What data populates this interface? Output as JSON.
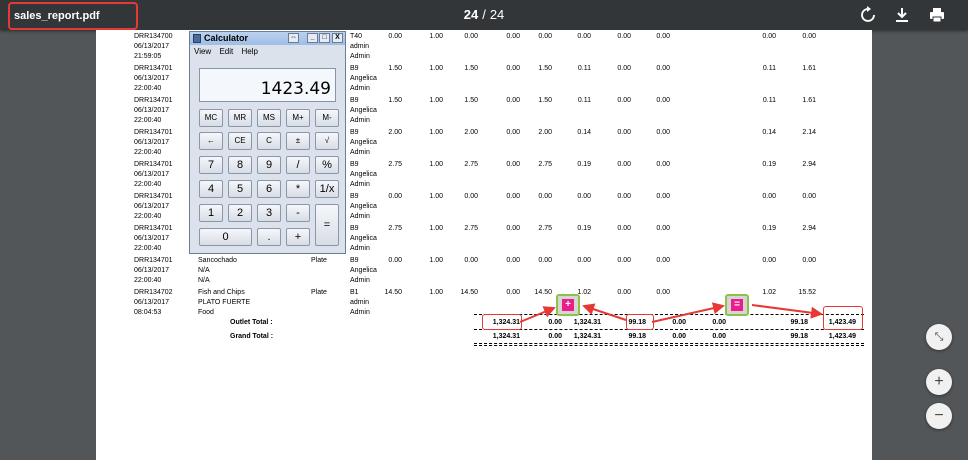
{
  "toolbar": {
    "title": "sales_report.pdf",
    "page_current": "24",
    "page_sep": "/",
    "page_total": "24",
    "icons": [
      "rotate-icon",
      "download-icon",
      "print-icon"
    ]
  },
  "report": {
    "rows": [
      {
        "id": "DRR134700",
        "date": "06/13/2017",
        "time": "21:59:05",
        "item": "",
        "cat": "",
        "type": "",
        "code": "T40",
        "user1": "admin",
        "user2": "Admin",
        "v": [
          "0.00",
          "1.00",
          "0.00",
          "0.00",
          "0.00",
          "0.00",
          "0.00",
          "0.00",
          "0.00",
          "0.00"
        ]
      },
      {
        "id": "DRR134701",
        "date": "06/13/2017",
        "time": "22:00:40",
        "item": "",
        "cat": "",
        "type": "",
        "code": "B9",
        "user1": "Angelica",
        "user2": "Admin",
        "v": [
          "1.50",
          "1.00",
          "1.50",
          "0.00",
          "1.50",
          "0.11",
          "0.00",
          "0.00",
          "0.11",
          "1.61"
        ]
      },
      {
        "id": "DRR134701",
        "date": "06/13/2017",
        "time": "22:00:40",
        "item": "",
        "cat": "",
        "type": "",
        "code": "B9",
        "user1": "Angelica",
        "user2": "Admin",
        "v": [
          "1.50",
          "1.00",
          "1.50",
          "0.00",
          "1.50",
          "0.11",
          "0.00",
          "0.00",
          "0.11",
          "1.61"
        ]
      },
      {
        "id": "DRR134701",
        "date": "06/13/2017",
        "time": "22:00:40",
        "item": "",
        "cat": "",
        "type": "",
        "code": "B9",
        "user1": "Angelica",
        "user2": "Admin",
        "v": [
          "2.00",
          "1.00",
          "2.00",
          "0.00",
          "2.00",
          "0.14",
          "0.00",
          "0.00",
          "0.14",
          "2.14"
        ]
      },
      {
        "id": "DRR134701",
        "date": "06/13/2017",
        "time": "22:00:40",
        "item": "",
        "cat": "",
        "type": "",
        "code": "B9",
        "user1": "Angelica",
        "user2": "Admin",
        "v": [
          "2.75",
          "1.00",
          "2.75",
          "0.00",
          "2.75",
          "0.19",
          "0.00",
          "0.00",
          "0.19",
          "2.94"
        ]
      },
      {
        "id": "DRR134701",
        "date": "06/13/2017",
        "time": "22:00:40",
        "item": "",
        "cat": "",
        "type": "",
        "code": "B9",
        "user1": "Angelica",
        "user2": "Admin",
        "v": [
          "0.00",
          "1.00",
          "0.00",
          "0.00",
          "0.00",
          "0.00",
          "0.00",
          "0.00",
          "0.00",
          "0.00"
        ]
      },
      {
        "id": "DRR134701",
        "date": "06/13/2017",
        "time": "22:00:40",
        "item": "",
        "cat": "",
        "type": "",
        "code": "B9",
        "user1": "Angelica",
        "user2": "Admin",
        "v": [
          "2.75",
          "1.00",
          "2.75",
          "0.00",
          "2.75",
          "0.19",
          "0.00",
          "0.00",
          "0.19",
          "2.94"
        ]
      },
      {
        "id": "DRR134701",
        "date": "06/13/2017",
        "time": "22:00:40",
        "item": "Sancochado",
        "cat": "N/A",
        "type": "Plate",
        "code": "B9",
        "user1": "Angelica",
        "user2": "Admin",
        "sub": "N/A",
        "v": [
          "0.00",
          "1.00",
          "0.00",
          "0.00",
          "0.00",
          "0.00",
          "0.00",
          "0.00",
          "0.00",
          "0.00"
        ]
      },
      {
        "id": "DRR134702",
        "date": "06/13/2017",
        "time": "08:04:53",
        "item": "Fish and Chips",
        "cat": "PLATO FUERTE",
        "type": "Plate",
        "code": "B1",
        "user1": "admin",
        "user2": "Admin",
        "sub": "Food",
        "v": [
          "14.50",
          "1.00",
          "14.50",
          "0.00",
          "14.50",
          "1.02",
          "0.00",
          "0.00",
          "1.02",
          "15.52"
        ]
      }
    ],
    "outlet_label": "Outlet Total :",
    "outlet_values": [
      "1,324.31",
      "0.00",
      "1,324.31",
      "99.18",
      "0.00",
      "0.00",
      "99.18",
      "1,423.49"
    ],
    "grand_label": "Grand Total :",
    "grand_values": [
      "1,324.31",
      "0.00",
      "1,324.31",
      "99.18",
      "0.00",
      "0.00",
      "99.18",
      "1,423.49"
    ],
    "plus_badge": "+",
    "equals_badge": "="
  },
  "calculator": {
    "title": "Calculator",
    "menu": [
      "View",
      "Edit",
      "Help"
    ],
    "display": "1423.49",
    "win_buttons": [
      "⇔",
      "_",
      "□",
      "X"
    ],
    "keys": {
      "r1": [
        "MC",
        "MR",
        "MS",
        "M+",
        "M-"
      ],
      "r2": [
        "←",
        "CE",
        "C",
        "±",
        "√"
      ],
      "r3": [
        "7",
        "8",
        "9",
        "/",
        "%"
      ],
      "r4": [
        "4",
        "5",
        "6",
        "*",
        "1/x"
      ],
      "r5": [
        "1",
        "2",
        "3",
        "-"
      ],
      "r6": [
        "0",
        ".",
        "+"
      ],
      "eq": "="
    }
  },
  "zoom": {
    "fit": "fit-page-icon",
    "in": "+",
    "out": "−"
  }
}
